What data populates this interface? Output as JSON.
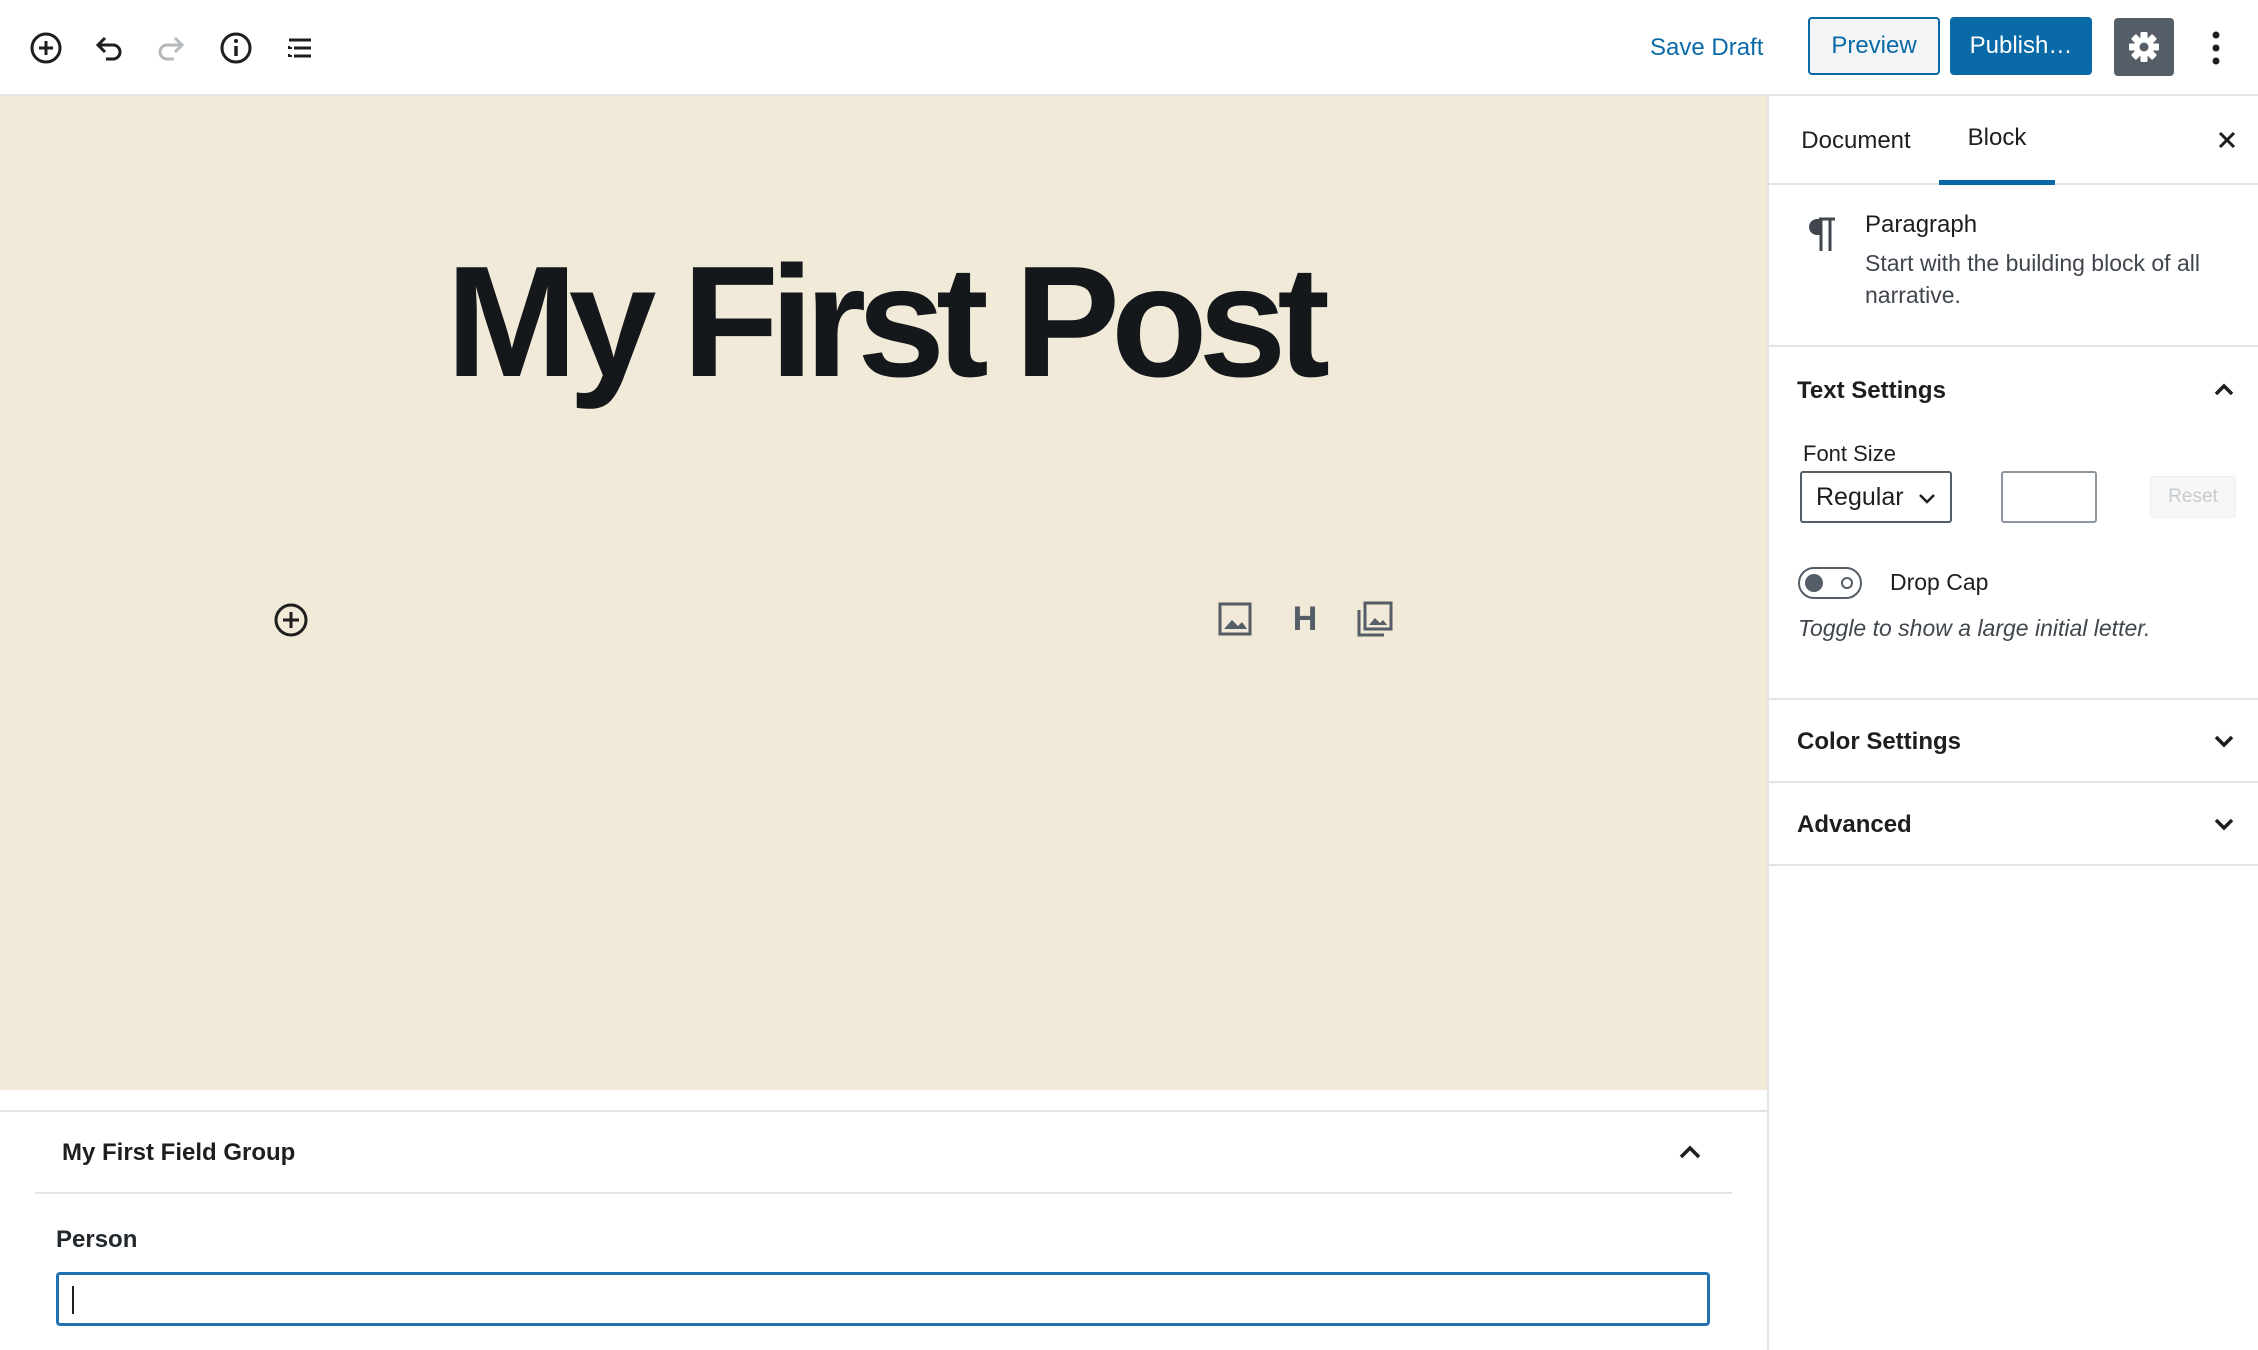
{
  "toolbar": {
    "icons": [
      "add-block-icon",
      "undo-icon",
      "redo-icon",
      "info-icon",
      "block-navigation-icon",
      "gear-icon",
      "more-options-icon"
    ],
    "save_draft": "Save Draft",
    "preview": "Preview",
    "publish": "Publish…"
  },
  "editor": {
    "title": "My First Post",
    "background_color": "#f1ead8",
    "quick_inserter_icons": [
      "image-icon",
      "heading-icon",
      "gallery-icon"
    ],
    "heading_glyph": "H"
  },
  "metabox": {
    "title": "My First Field Group",
    "field_label": "Person",
    "field_value": ""
  },
  "sidebar": {
    "tabs": [
      {
        "label": "Document",
        "active": false
      },
      {
        "label": "Block",
        "active": true
      }
    ],
    "block": {
      "icon": "paragraph-icon",
      "name": "Paragraph",
      "description": "Start with the building block of all narrative."
    },
    "text_settings": {
      "title": "Text Settings",
      "expanded": true,
      "font_size_label": "Font Size",
      "font_size_value": "Regular",
      "custom_size_value": "",
      "reset_label": "Reset",
      "drop_cap_label": "Drop Cap",
      "drop_cap_enabled": false,
      "drop_cap_help": "Toggle to show a large initial letter."
    },
    "color_settings": {
      "title": "Color Settings",
      "expanded": false
    },
    "advanced": {
      "title": "Advanced",
      "expanded": false
    }
  },
  "colors": {
    "accent": "#0a6aa8",
    "dark_button": "#555d66",
    "border": "#e2e4e7"
  }
}
